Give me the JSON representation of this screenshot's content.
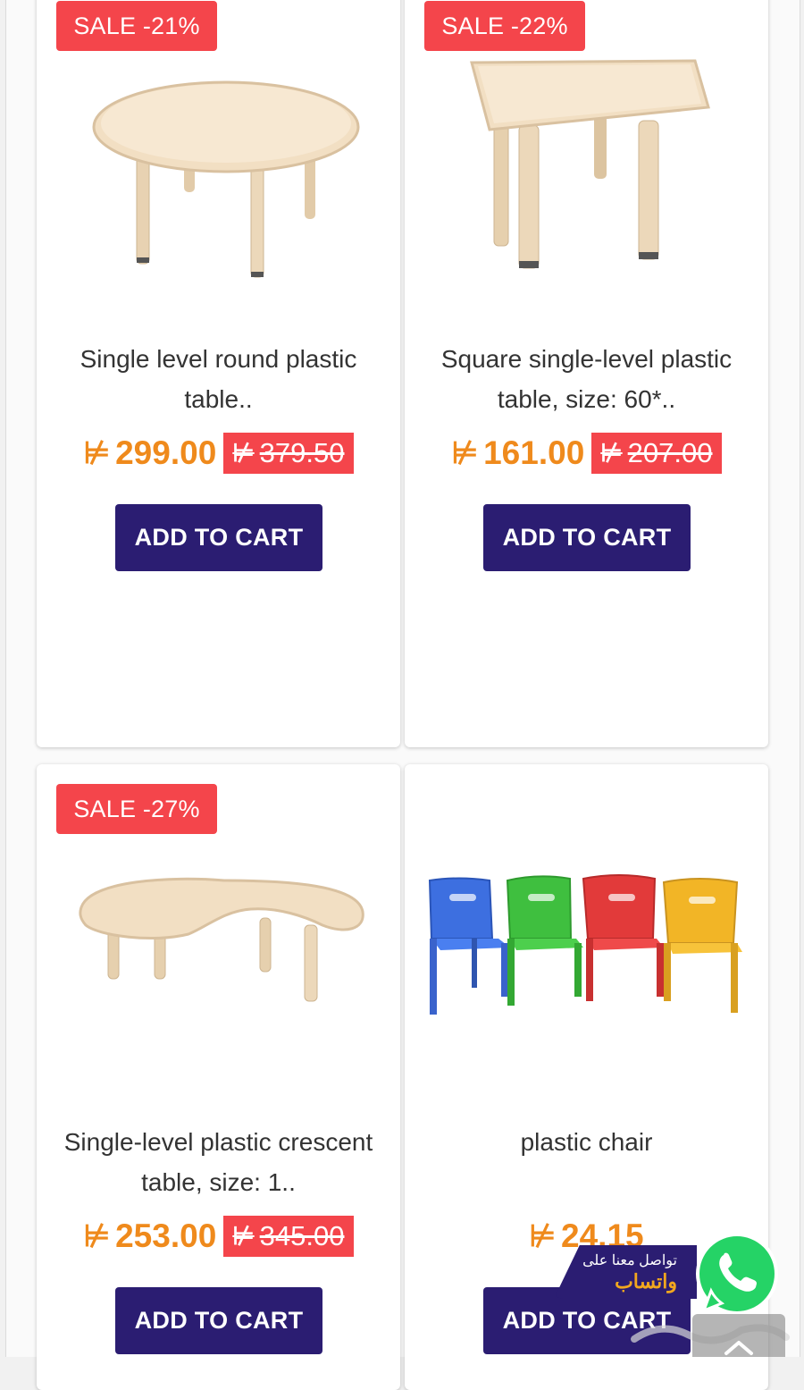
{
  "colors": {
    "sale_badge": "#f4454b",
    "price": "#ef8a1c",
    "button": "#2b1d72",
    "title_text": "#333333",
    "whatsapp": "#25d366"
  },
  "currency_symbol": "SAR-symbol",
  "products": [
    {
      "badge": "SALE -21%",
      "image_icon": "round-table",
      "title": "Single level round plastic table..",
      "price": "299.00",
      "old_price": "379.50",
      "button": "ADD TO CART"
    },
    {
      "badge": "SALE -22%",
      "image_icon": "square-table",
      "title": "Square single-level plastic table, size: 60*..",
      "price": "161.00",
      "old_price": "207.00",
      "button": "ADD TO CART"
    },
    {
      "badge": "SALE -27%",
      "image_icon": "crescent-table",
      "title": "Single-level plastic crescent table, size: 1..",
      "price": "253.00",
      "old_price": "345.00",
      "button": "ADD TO CART"
    },
    {
      "badge": "",
      "image_icon": "plastic-chairs",
      "title": "plastic chair",
      "price": "24.15",
      "old_price": "",
      "button": "ADD TO CART"
    }
  ],
  "whatsapp_widget": {
    "line1": "تواصل معنا على",
    "line2": "واتساب",
    "icon": "whatsapp-phone-icon"
  },
  "scroll_top_icon": "chevron-up-icon"
}
